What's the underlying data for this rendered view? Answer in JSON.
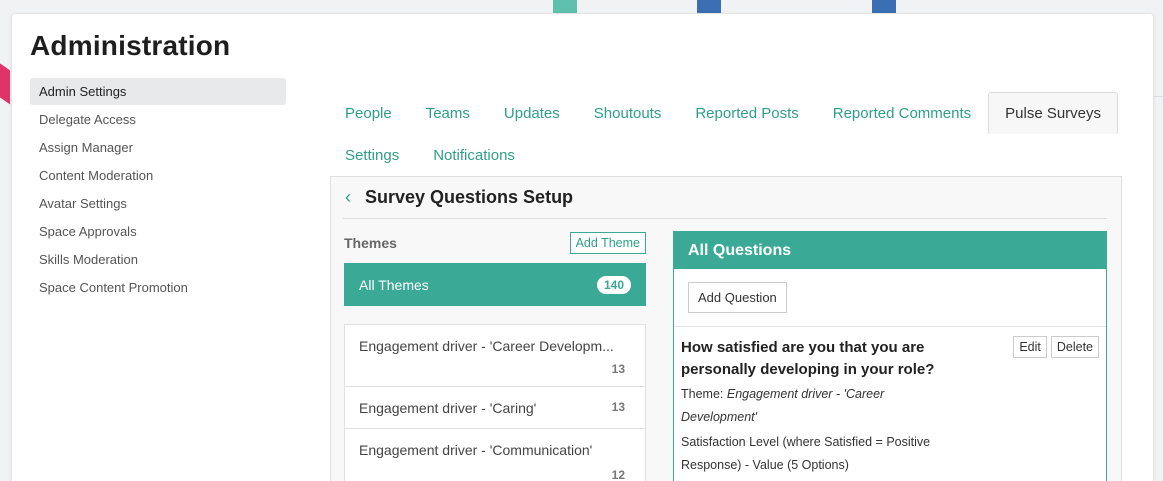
{
  "app": {
    "title": "Administration"
  },
  "sidebar": {
    "items": [
      {
        "label": "Admin Settings",
        "active": true
      },
      {
        "label": "Delegate Access"
      },
      {
        "label": "Assign Manager"
      },
      {
        "label": "Content Moderation"
      },
      {
        "label": "Avatar Settings"
      },
      {
        "label": "Space Approvals"
      },
      {
        "label": "Skills Moderation"
      },
      {
        "label": "Space Content Promotion"
      }
    ]
  },
  "tabs": {
    "row1": [
      "People",
      "Teams",
      "Updates",
      "Shoutouts",
      "Reported Posts",
      "Reported Comments",
      "Pulse Surveys"
    ],
    "row2": [
      "Settings",
      "Notifications"
    ],
    "active": "Pulse Surveys"
  },
  "content": {
    "back_icon": "chevron-left-icon",
    "title": "Survey Questions Setup"
  },
  "themes": {
    "label": "Themes",
    "add_label": "Add Theme",
    "all_label": "All Themes",
    "all_count": "140",
    "items": [
      {
        "name": "Engagement driver - 'Career Developm...",
        "count": "13"
      },
      {
        "name": "Engagement driver - 'Caring'",
        "count": "13"
      },
      {
        "name": "Engagement driver - 'Communication'",
        "count": "12"
      }
    ]
  },
  "questions": {
    "header": "All Questions",
    "add_label": "Add Question",
    "items": [
      {
        "title": "How satisfied are you that you are personally developing in your role?",
        "theme_prefix": "Theme: ",
        "theme": "Engagement driver - 'Career Development'",
        "type": "Satisfaction Level (where Satisfied = Positive Response) - Value (5 Options)",
        "edit_label": "Edit",
        "delete_label": "Delete"
      }
    ]
  },
  "colors": {
    "accent": "#3aa996",
    "link": "#2f9e89"
  }
}
